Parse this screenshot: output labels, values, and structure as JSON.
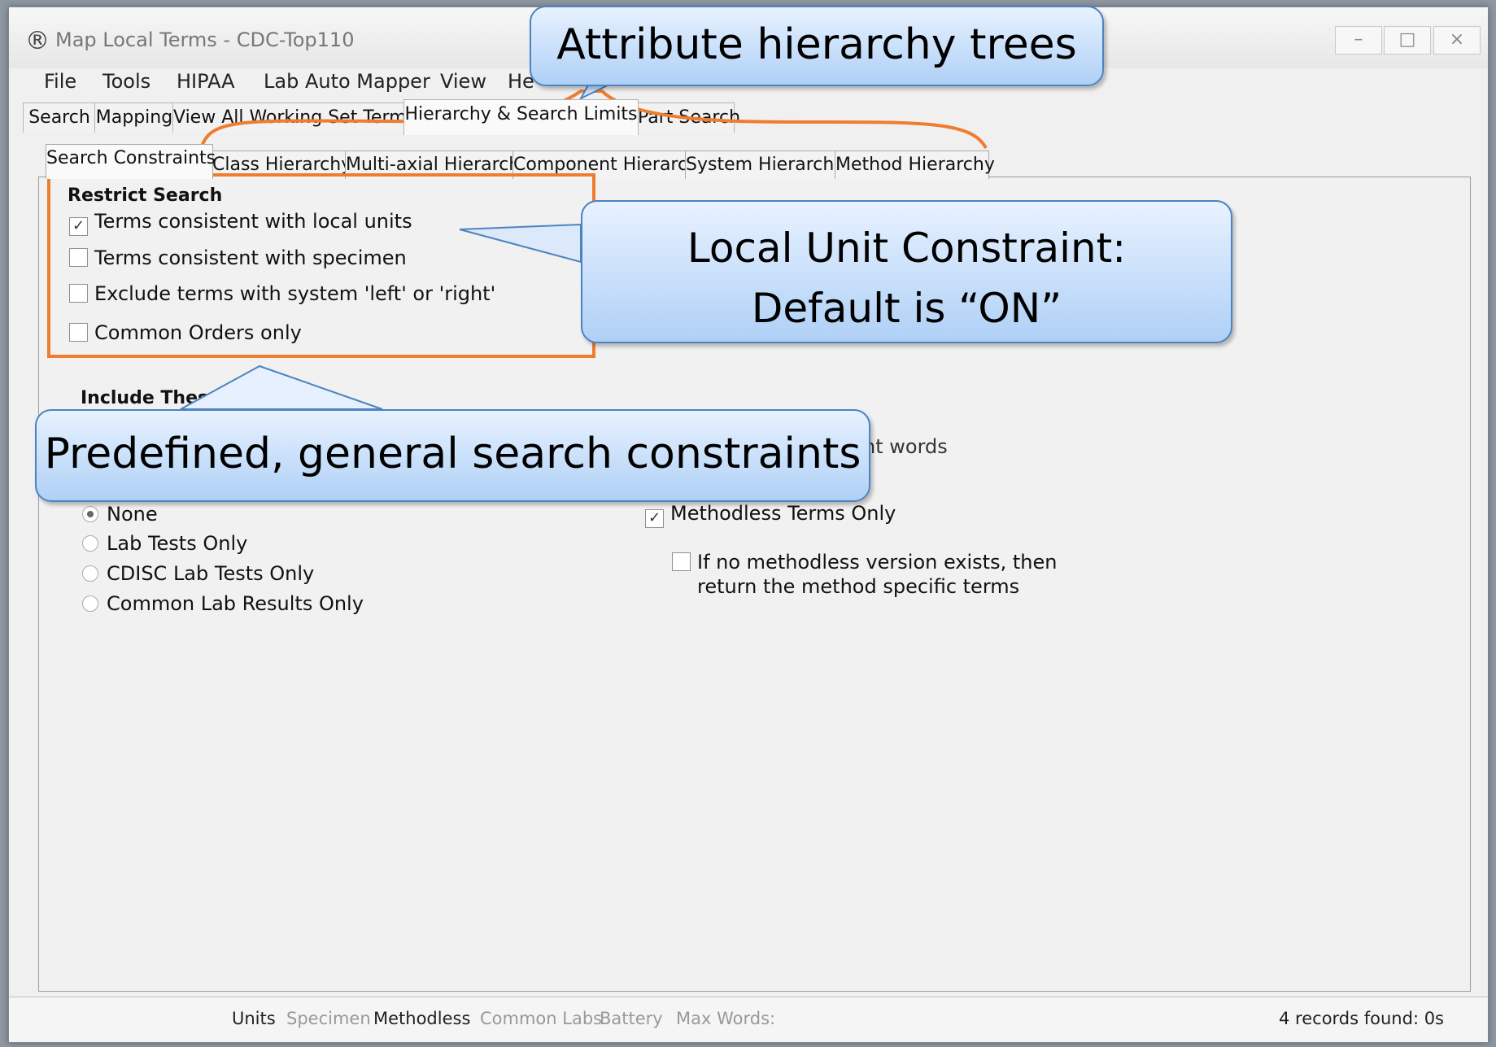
{
  "window": {
    "title": "Map Local Terms - CDC-Top110",
    "app_icon": "rgcm-logo-icon",
    "controls": [
      "minimize-icon",
      "maximize-icon",
      "close-icon"
    ]
  },
  "menu": [
    "File",
    "Tools",
    "HIPAA",
    "Lab Auto Mapper",
    "View",
    "He"
  ],
  "main_tabs": [
    "Search",
    "Mapping",
    "View All Working Set Terms",
    "Hierarchy & Search Limits",
    "Part Search"
  ],
  "sub_tabs": [
    "Search Constraints",
    "Class Hierarchy",
    "Multi-axial Hierarchy",
    "Component Hierarchy",
    "System Hierarchy",
    "Method Hierarchy"
  ],
  "restrict_search": {
    "title": "Restrict Search",
    "options": [
      {
        "label": "Terms consistent with local units",
        "checked": true
      },
      {
        "label": "Terms consistent with specimen",
        "checked": false
      },
      {
        "label": "Exclude terms with system 'left' or 'right'",
        "checked": false
      },
      {
        "label": "Common Orders only",
        "checked": false
      }
    ]
  },
  "include_these": {
    "title_partial": "Include These"
  },
  "radio_options": [
    {
      "label": "None",
      "selected": true
    },
    {
      "label": "Lab Tests Only",
      "selected": false
    },
    {
      "label": "CDISC Lab Tests Only",
      "selected": false
    },
    {
      "label": "Common Lab Results Only",
      "selected": false
    }
  ],
  "right_options": {
    "partial_text": "nt words",
    "methodless": {
      "label": "Methodless Terms Only",
      "checked": true
    },
    "fallback": {
      "line1": "If no methodless version exists, then",
      "line2": "return the method specific terms",
      "checked": false
    }
  },
  "statusbar": {
    "items": [
      {
        "label": "Units",
        "active": true
      },
      {
        "label": "Specimen",
        "active": false
      },
      {
        "label": "Methodless",
        "active": true
      },
      {
        "label": "Common Labs",
        "active": false
      },
      {
        "label": "Battery",
        "active": false
      },
      {
        "label": "Max Words:",
        "active": false
      }
    ],
    "count_text": "4 records found: 0s"
  },
  "callouts": {
    "attribute": "Attribute hierarchy trees",
    "local_unit_line1": "Local Unit Constraint:",
    "local_unit_line2": "Default is “ON”",
    "predefined": "Predefined, general search constraints"
  },
  "annotation_colors": {
    "highlight": "#ef7d2f",
    "callout_border": "#4d83c0",
    "callout_fill": "#b9d7f7"
  }
}
